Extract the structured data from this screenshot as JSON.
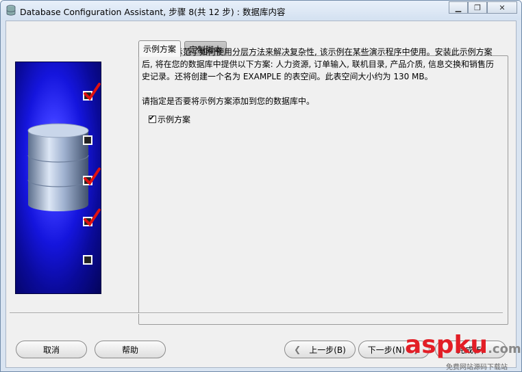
{
  "window": {
    "title": "Database Configuration Assistant, 步骤 8(共 12 步) : 数据库内容",
    "controls": {
      "minimize": "minimize",
      "restore": "restore",
      "close": "close"
    }
  },
  "tabs": [
    {
      "label": "示例方案",
      "active": true
    },
    {
      "label": "定制脚本",
      "active": false
    }
  ],
  "content": {
    "description": "示例方案示范了如何使用分层方法来解决复杂性, 该示例在某些演示程序中使用。安装此示例方案后, 将在您的数据库中提供以下方案: 人力资源, 订单输入, 联机目录, 产品介质, 信息交换和销售历史记录。还将创建一个名为 EXAMPLE 的表空间。此表空间大小约为 130 MB。",
    "prompt": "请指定是否要将示例方案添加到您的数据库中。",
    "checkbox": {
      "label": "示例方案",
      "checked": true
    }
  },
  "sidebar_checks": [
    true,
    false,
    true,
    true,
    false
  ],
  "buttons": {
    "cancel": "取消",
    "help": "帮助",
    "back": "上一步(B)",
    "next": "下一步(N)",
    "finish": "完成(F)"
  },
  "watermark": {
    "text": "aspku",
    "suffix": ".com",
    "subtext": "免费网站源码下载站"
  },
  "colors": {
    "accent_red": "#e21e26",
    "sidebar_blue": "#1515dd"
  }
}
